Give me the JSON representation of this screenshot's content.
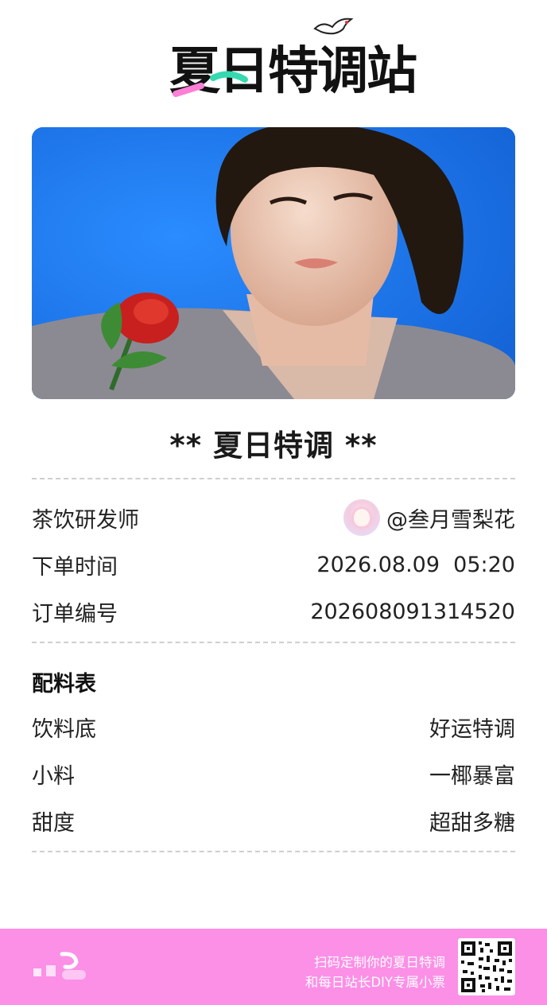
{
  "logo": {
    "text": "夏日特调站"
  },
  "photo": {
    "description_icon": "portrait-photo"
  },
  "receipt": {
    "title": "** 夏日特调 **",
    "info_rows": [
      {
        "label": "茶饮研发师",
        "value": "@叁月雪梨花"
      },
      {
        "label": "下单时间",
        "value": "2026.08.09  05:20"
      },
      {
        "label": "订单编号",
        "value": "202608091314520"
      }
    ],
    "ingredients_title": "配料表",
    "ingredient_rows": [
      {
        "label": "饮料底",
        "value": "好运特调"
      },
      {
        "label": "小料",
        "value": "一椰暴富"
      },
      {
        "label": "甜度",
        "value": "超甜多糖"
      }
    ]
  },
  "footer": {
    "line1": "扫码定制你的夏日特调",
    "line2": "和每日站长DIY专属小票",
    "background": "#fc8fe6"
  },
  "colors": {
    "photo_bg": "#1c78f0",
    "accent_green": "#35d9b0",
    "accent_pink": "#ff7fd6"
  }
}
